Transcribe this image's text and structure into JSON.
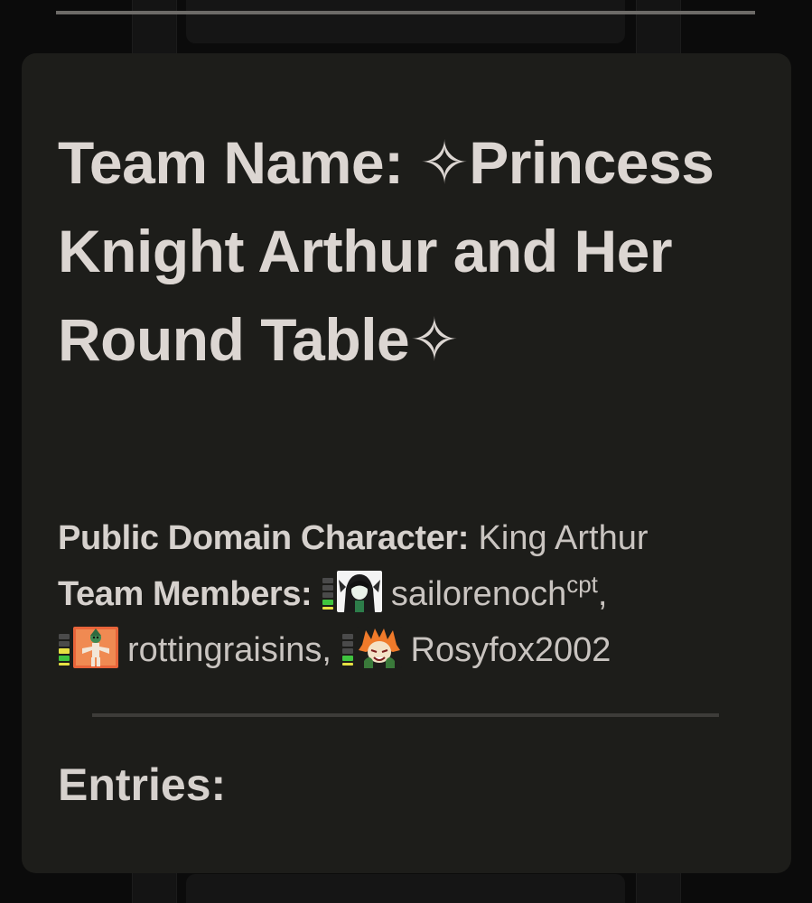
{
  "team": {
    "title": "Team Name: ✧Princess Knight Arthur and Her Round Table✧"
  },
  "character": {
    "label": "Public Domain Character:",
    "value": "King Arthur"
  },
  "members": {
    "label": "Team Members:",
    "list": [
      {
        "name": "sailorenoch",
        "suffix": "cpt",
        "separator": ","
      },
      {
        "name": "rottingraisins",
        "suffix": "",
        "separator": ","
      },
      {
        "name": "Rosyfox2002",
        "suffix": "",
        "separator": ""
      }
    ]
  },
  "entries": {
    "heading": "Entries:"
  }
}
